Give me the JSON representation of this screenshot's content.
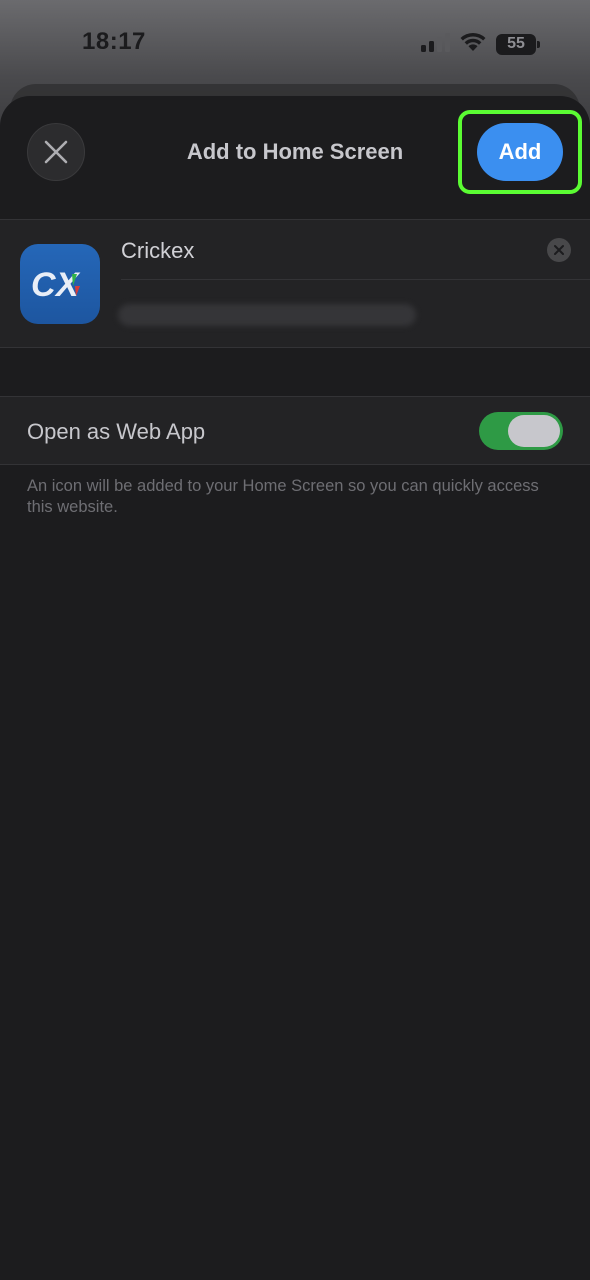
{
  "status_bar": {
    "time": "18:17",
    "battery_level": "55",
    "icons": [
      "cellular-signal-icon",
      "wifi-icon",
      "battery-icon"
    ]
  },
  "sheet": {
    "title": "Add to Home Screen",
    "close_icon": "close-icon",
    "add_label": "Add",
    "accent_color": "#3b8ff0",
    "highlight_color": "#5bfb33"
  },
  "app": {
    "icon_text": "CX",
    "name": "Crickex",
    "clear_icon": "clear-circle-icon"
  },
  "web_app_option": {
    "label": "Open as Web App",
    "enabled": true,
    "toggle_color": "#2e9a45"
  },
  "footnote": "An icon will be added to your Home Screen so you can quickly access this website."
}
